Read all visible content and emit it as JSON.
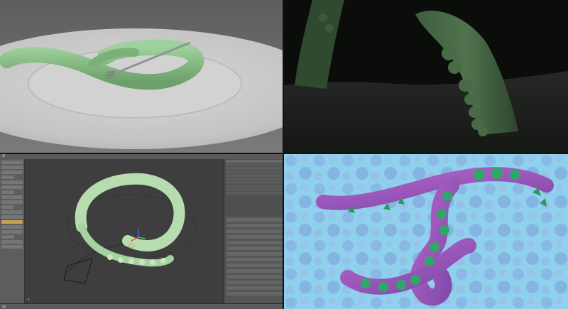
{
  "colors": {
    "tentacle_green": "#8cc08a",
    "plate_white": "#e8e8e8",
    "dark_bg": "#141814",
    "blender_bg": "#4a4a4a",
    "bright_green": "#2d9b63",
    "purple": "#a060c0",
    "blue_bg": "#7fc6e8"
  },
  "panels": {
    "top_left": {
      "name": "render-plate-fork"
    },
    "top_right": {
      "name": "render-dark-tentacles"
    },
    "bottom_left": {
      "name": "blender-editor"
    },
    "bottom_right": {
      "name": "render-purple-tentacle"
    }
  },
  "blender": {
    "icons": {
      "menu": "menu-icon",
      "view": "view-icon",
      "camera": "camera-icon",
      "axes": "axis-gizmo-icon"
    }
  }
}
